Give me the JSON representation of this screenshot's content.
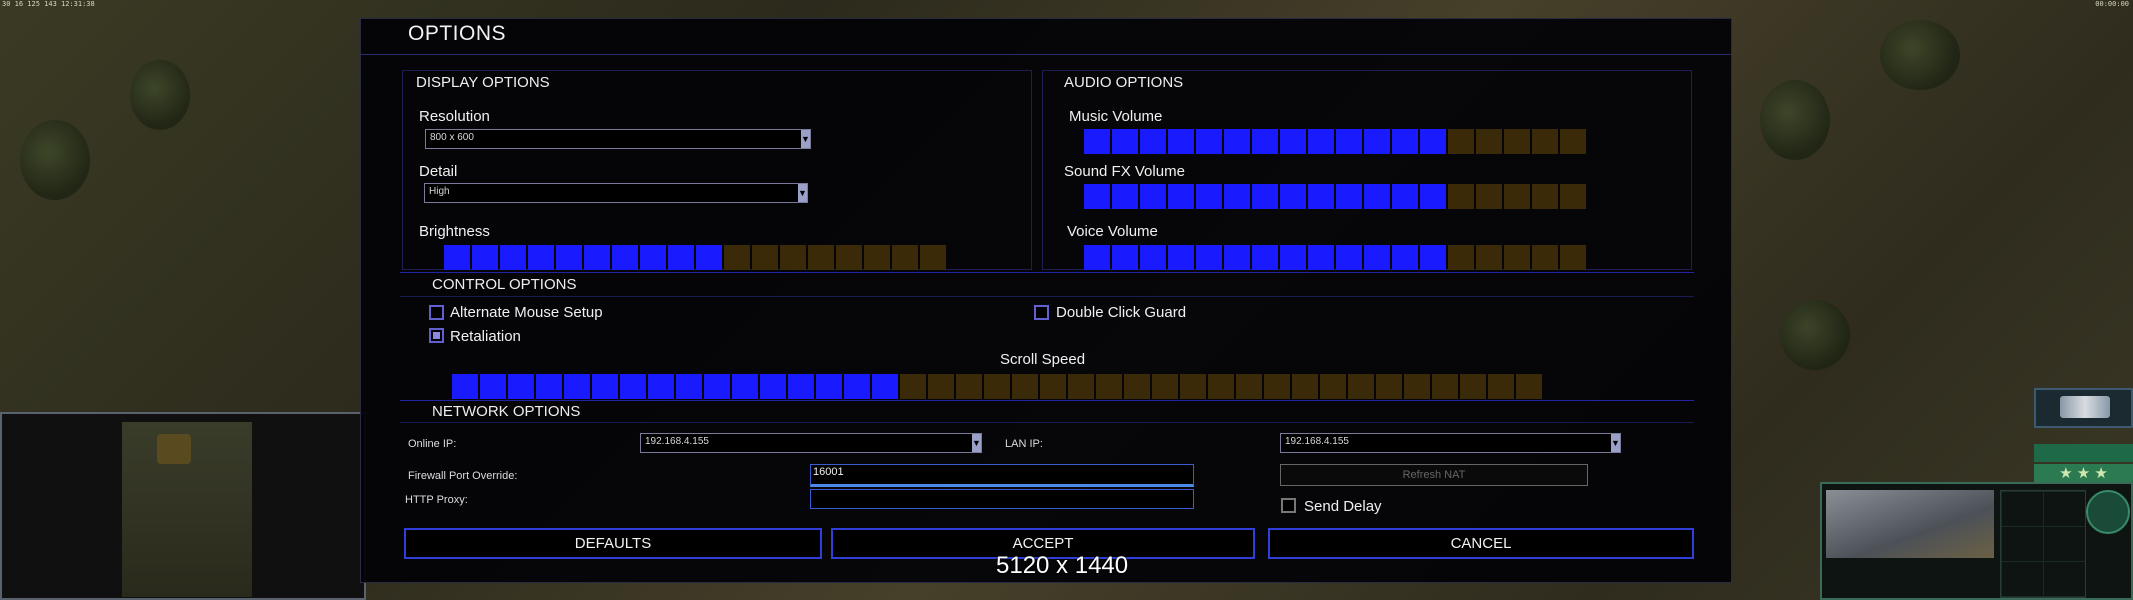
{
  "hud": {
    "top_left": "30 16 125 143 12:31:38",
    "top_right": "00:00:00"
  },
  "window": {
    "title": "OPTIONS"
  },
  "display": {
    "header": "DISPLAY OPTIONS",
    "resolution_label": "Resolution",
    "resolution_value": "800 x 600",
    "detail_label": "Detail",
    "detail_value": "High",
    "brightness_label": "Brightness",
    "brightness_level": 10,
    "brightness_segments": 18
  },
  "audio": {
    "header": "AUDIO OPTIONS",
    "music_label": "Music Volume",
    "music_level": 13,
    "sfx_label": "Sound FX Volume",
    "sfx_level": 13,
    "voice_label": "Voice Volume",
    "voice_level": 13,
    "segments": 18
  },
  "control": {
    "header": "CONTROL OPTIONS",
    "alt_mouse_label": "Alternate Mouse Setup",
    "alt_mouse_checked": false,
    "retaliation_label": "Retaliation",
    "retaliation_checked": true,
    "double_click_label": "Double Click Guard",
    "double_click_checked": false,
    "scroll_label": "Scroll Speed",
    "scroll_level": 16,
    "scroll_segments": 39
  },
  "network": {
    "header": "NETWORK OPTIONS",
    "online_ip_label": "Online IP:",
    "online_ip_value": "192.168.4.155",
    "lan_ip_label": "LAN IP:",
    "lan_ip_value": "192.168.4.155",
    "firewall_label": "Firewall Port Override:",
    "firewall_value": "16001",
    "proxy_label": "HTTP Proxy:",
    "proxy_value": "",
    "refresh_nat_label": "Refresh NAT",
    "send_delay_label": "Send Delay",
    "send_delay_checked": false
  },
  "buttons": {
    "defaults": "DEFAULTS",
    "accept": "ACCEPT",
    "cancel": "CANCEL"
  },
  "resolution_overlay": "5120 x 1440",
  "colors": {
    "bar_on": "#1a1aff",
    "bar_off": "#3a2a08",
    "border": "#2f3fd8"
  }
}
